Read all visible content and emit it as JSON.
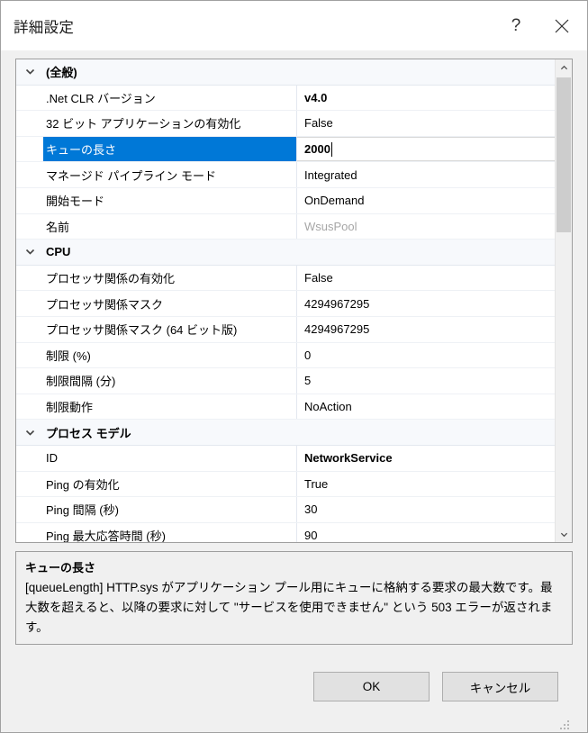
{
  "window": {
    "title": "詳細設定",
    "help_icon": "question-mark-icon",
    "close_icon": "close-icon"
  },
  "grid": {
    "groups": [
      {
        "label": "(全般)",
        "expanded": true,
        "rows": [
          {
            "name": ".Net CLR バージョン",
            "value": "v4.0",
            "bold": true,
            "dim": false
          },
          {
            "name": "32 ビット アプリケーションの有効化",
            "value": "False",
            "bold": false,
            "dim": false
          },
          {
            "name": "キューの長さ",
            "value": "2000",
            "bold": true,
            "dim": false,
            "selected": true,
            "editing": true
          },
          {
            "name": "マネージド パイプライン モード",
            "value": "Integrated",
            "bold": false,
            "dim": false
          },
          {
            "name": "開始モード",
            "value": "OnDemand",
            "bold": false,
            "dim": false
          },
          {
            "name": "名前",
            "value": "WsusPool",
            "bold": false,
            "dim": true
          }
        ]
      },
      {
        "label": "CPU",
        "expanded": true,
        "rows": [
          {
            "name": "プロセッサ関係の有効化",
            "value": "False",
            "bold": false,
            "dim": false
          },
          {
            "name": "プロセッサ関係マスク",
            "value": "4294967295",
            "bold": false,
            "dim": false
          },
          {
            "name": "プロセッサ関係マスク (64 ビット版)",
            "value": "4294967295",
            "bold": false,
            "dim": false
          },
          {
            "name": "制限 (%)",
            "value": "0",
            "bold": false,
            "dim": false
          },
          {
            "name": "制限間隔 (分)",
            "value": "5",
            "bold": false,
            "dim": false
          },
          {
            "name": "制限動作",
            "value": "NoAction",
            "bold": false,
            "dim": false
          }
        ]
      },
      {
        "label": "プロセス モデル",
        "expanded": true,
        "rows": [
          {
            "name": "ID",
            "value": "NetworkService",
            "bold": true,
            "dim": false
          },
          {
            "name": "Ping の有効化",
            "value": "True",
            "bold": false,
            "dim": false
          },
          {
            "name": "Ping 間隔 (秒)",
            "value": "30",
            "bold": false,
            "dim": false
          },
          {
            "name": "Ping 最大応答時間 (秒)",
            "value": "90",
            "bold": false,
            "dim": false
          }
        ]
      }
    ],
    "scrollbar": {
      "up_icon": "chevron-up-icon",
      "down_icon": "chevron-down-icon"
    }
  },
  "description": {
    "title": "キューの長さ",
    "text": "[queueLength] HTTP.sys がアプリケーション プール用にキューに格納する要求の最大数です。最大数を超えると、以降の要求に対して \"サービスを使用できません\" という 503 エラーが返されます。"
  },
  "footer": {
    "ok_label": "OK",
    "cancel_label": "キャンセル"
  },
  "colors": {
    "selection": "#0078d7",
    "dialog_background": "#f0f0f0",
    "group_row": "#f7f9fc",
    "disabled_text": "#a6a6a6"
  }
}
